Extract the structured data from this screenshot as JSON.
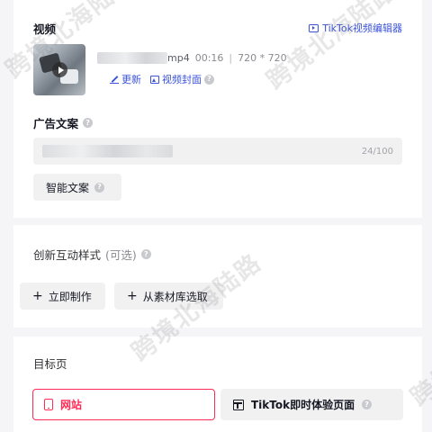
{
  "video": {
    "label": "视频",
    "editor_link": "TikTok视频编辑器",
    "file_suffix": "mp4",
    "duration": "00:16",
    "separator": "|",
    "resolution": "720 * 720",
    "update_label": "更新",
    "cover_label": "视频封面"
  },
  "ad_copy": {
    "label": "广告文案",
    "counter": "24/100",
    "smart_copy_label": "智能文案"
  },
  "creative": {
    "label": "创新互动样式",
    "optional": "(可选)",
    "create_now_label": "立即制作",
    "from_library_label": "从素材库选取"
  },
  "target_page": {
    "label": "目标页",
    "option_website": "网站",
    "option_instant": "TikTok即时体验页面"
  },
  "watermark": {
    "text": "跨境北海陆路"
  },
  "colors": {
    "accent_pink": "#fe2c55",
    "link_blue": "#3b53d8"
  }
}
